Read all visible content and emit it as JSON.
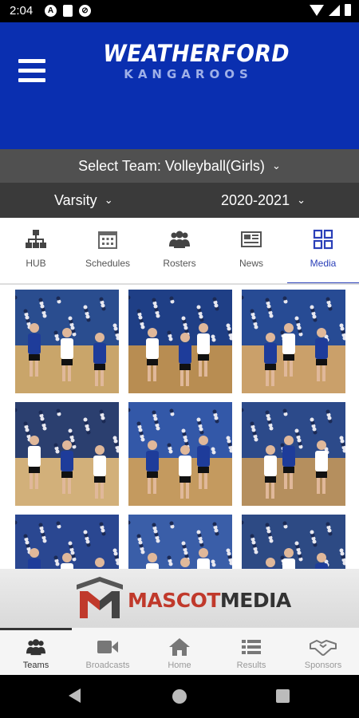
{
  "status_bar": {
    "time": "2:04",
    "icons": [
      "a-icon",
      "sd-card-icon",
      "no-sync-icon"
    ],
    "right_icons": [
      "wifi-icon",
      "signal-icon",
      "battery-icon"
    ]
  },
  "header": {
    "title": "WEATHERFORD",
    "subtitle": "KANGAROOS",
    "background": "#0a2fb0"
  },
  "team_select": {
    "label": "Select Team:",
    "value": "Volleyball(Girls)"
  },
  "level_select": {
    "value": "Varsity"
  },
  "season_select": {
    "value": "2020-2021"
  },
  "tabs": [
    {
      "label": "HUB",
      "icon": "hierarchy-icon",
      "active": false
    },
    {
      "label": "Schedules",
      "icon": "calendar-icon",
      "active": false
    },
    {
      "label": "Rosters",
      "icon": "people-icon",
      "active": false
    },
    {
      "label": "News",
      "icon": "newspaper-icon",
      "active": false
    },
    {
      "label": "Media",
      "icon": "grid-icon",
      "active": true
    }
  ],
  "media": {
    "photos": [
      "volleyball-photo-1",
      "volleyball-photo-2",
      "volleyball-photo-3",
      "volleyball-photo-4",
      "volleyball-photo-5",
      "volleyball-photo-6",
      "volleyball-photo-7",
      "volleyball-photo-8",
      "volleyball-photo-9"
    ]
  },
  "sponsor_banner": {
    "brand_part1": "MASCOT",
    "brand_part2": "MEDIA",
    "accent": "#c0392b"
  },
  "bottom_nav": [
    {
      "label": "Teams",
      "icon": "people-icon",
      "active": true
    },
    {
      "label": "Broadcasts",
      "icon": "video-camera-icon",
      "active": false
    },
    {
      "label": "Home",
      "icon": "home-icon",
      "active": false
    },
    {
      "label": "Results",
      "icon": "list-icon",
      "active": false
    },
    {
      "label": "Sponsors",
      "icon": "handshake-icon",
      "active": false
    }
  ],
  "colors": {
    "accent": "#2a3fb8",
    "brand_blue": "#0a2fb0"
  }
}
